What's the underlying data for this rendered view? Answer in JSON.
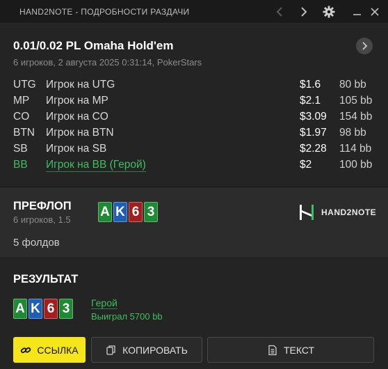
{
  "window": {
    "title": "HAND2NOTE - ПОДРОБНОСТИ РАЗДАЧИ",
    "icons": [
      "chevron-left-icon",
      "chevron-right-icon",
      "gear-icon",
      "minimize-icon",
      "close-icon"
    ]
  },
  "game": {
    "title": "0.01/0.02 PL Omaha Hold'em",
    "subtitle": "6 игроков, 2 августа 2025 0:31:14, PokerStars"
  },
  "players": [
    {
      "pos": "UTG",
      "name": "Игрок на UTG",
      "stack": "$1.6",
      "bb": "80 bb",
      "hero": false
    },
    {
      "pos": "MP",
      "name": "Игрок на MP",
      "stack": "$2.1",
      "bb": "105 bb",
      "hero": false
    },
    {
      "pos": "CO",
      "name": "Игрок на CO",
      "stack": "$3.09",
      "bb": "154 bb",
      "hero": false
    },
    {
      "pos": "BTN",
      "name": "Игрок на BTN",
      "stack": "$1.97",
      "bb": "98 bb",
      "hero": false
    },
    {
      "pos": "SB",
      "name": "Игрок на SB",
      "stack": "$2.28",
      "bb": "114 bb",
      "hero": false
    },
    {
      "pos": "BB",
      "name": "Игрок на BB (Герой)",
      "stack": "$2",
      "bb": "100 bb",
      "hero": true
    }
  ],
  "preflop": {
    "title": "ПРЕФЛОП",
    "subtitle": "6 игроков, 1.5",
    "cards": [
      {
        "rank": "A",
        "color": "green"
      },
      {
        "rank": "K",
        "color": "blue"
      },
      {
        "rank": "6",
        "color": "red"
      },
      {
        "rank": "3",
        "color": "green"
      }
    ],
    "action": "5 фолдов",
    "logo_text": "HAND2NOTE"
  },
  "result": {
    "title": "РЕЗУЛЬТАТ",
    "cards": [
      {
        "rank": "A",
        "color": "green"
      },
      {
        "rank": "K",
        "color": "blue"
      },
      {
        "rank": "6",
        "color": "red"
      },
      {
        "rank": "3",
        "color": "green"
      }
    ],
    "player": "Герой",
    "outcome": "Выиграл 5700 bb"
  },
  "buttons": {
    "link": "ССЫЛКА",
    "copy": "КОПИРОВАТЬ",
    "text": "ТЕКСТ"
  },
  "colors": {
    "hero_green": "#3fbf5f",
    "accent_yellow": "#f5e61a",
    "card_green": "#1e8a32",
    "card_blue": "#1d5fb5",
    "card_red": "#a31e1e"
  }
}
